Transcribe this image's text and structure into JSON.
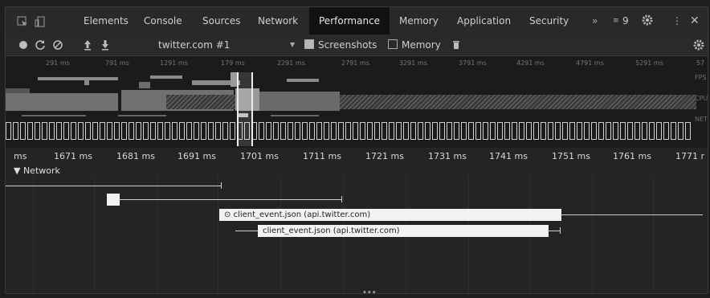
{
  "tabs": {
    "items": [
      "Elements",
      "Console",
      "Sources",
      "Network",
      "Performance",
      "Memory",
      "Application",
      "Security"
    ],
    "active": "Performance",
    "overflow": "»",
    "issues_count": "9"
  },
  "toolbar": {
    "recording": "twitter.com #1",
    "screenshots_label": "Screenshots",
    "memory_label": "Memory"
  },
  "overview": {
    "ticks": [
      "291 ms",
      "791 ms",
      "1291 ms",
      "179 ms",
      "2291 ms",
      "2791 ms",
      "3291 ms",
      "3791 ms",
      "4291 ms",
      "4791 ms",
      "5291 ms",
      "57"
    ],
    "side_labels": [
      "FPS",
      "CPU",
      "NET"
    ]
  },
  "ruler": {
    "ticks": [
      "ms",
      "1671 ms",
      "1681 ms",
      "1691 ms",
      "1701 ms",
      "1711 ms",
      "1721 ms",
      "1731 ms",
      "1741 ms",
      "1751 ms",
      "1761 ms",
      "1771 r"
    ]
  },
  "network": {
    "title": "▼ Network",
    "requests": [
      {
        "label": "⊙ client_event.json (api.twitter.com)"
      },
      {
        "label": "client_event.json (api.twitter.com)"
      }
    ]
  }
}
